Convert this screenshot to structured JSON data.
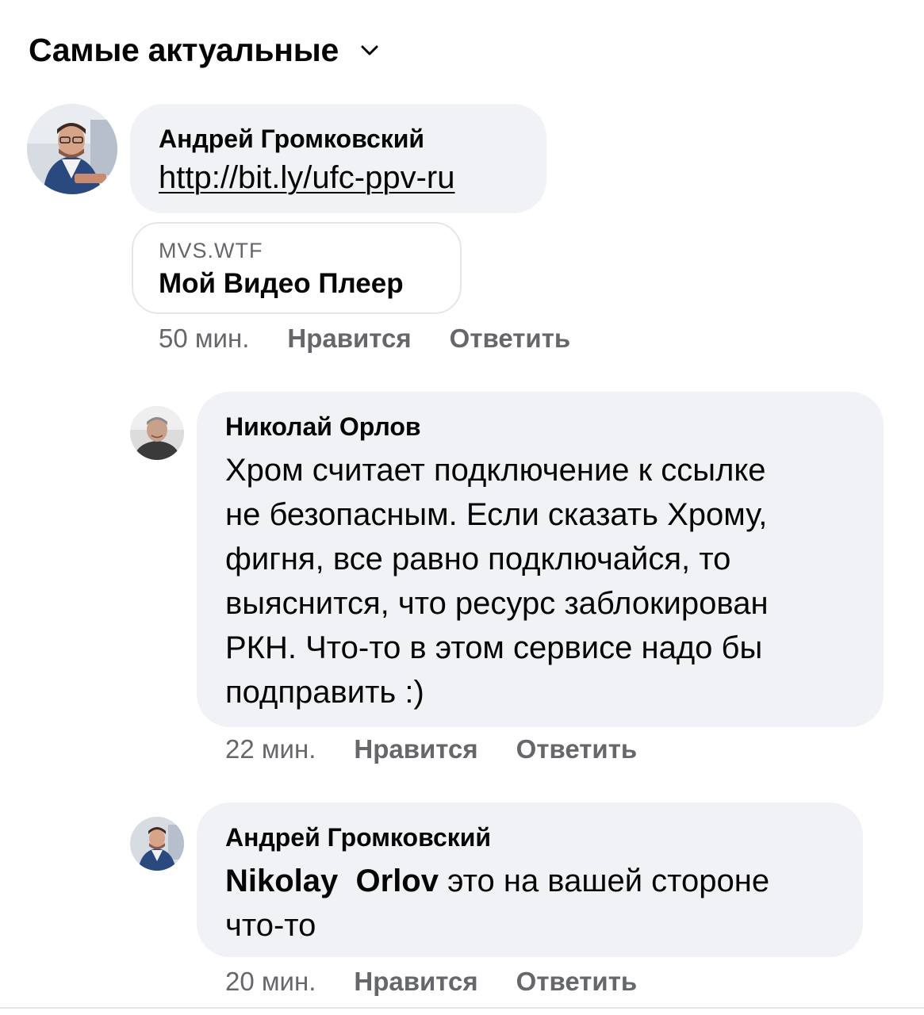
{
  "header": {
    "sort_label": "Самые актуальные"
  },
  "comments": [
    {
      "author": "Андрей Громковский",
      "link": "http://bit.ly/ufc-ppv-ru",
      "preview": {
        "domain": "MVS.WTF",
        "title": "Мой Видео Плеер"
      },
      "time": "50 мин.",
      "like_label": "Нравится",
      "reply_label": "Ответить"
    },
    {
      "author": "Николай Орлов",
      "text_lines": [
        "Хром считает подключение к ссылке",
        "не безопасным. Если сказать Хрому,",
        "фигня, все равно подключайся, то",
        "выяснится, что ресурс заблокирован",
        "РКН. Что-то в этом сервисе надо бы",
        "подправить :)"
      ],
      "time": "22 мин.",
      "like_label": "Нравится",
      "reply_label": "Ответить"
    },
    {
      "author": "Андрей Громковский",
      "mention": "Nikolay  Orlov",
      "text_after_mention": " это на вашей стороне",
      "text_line2": "что-то",
      "time": "20 мин.",
      "like_label": "Нравится",
      "reply_label": "Ответить"
    }
  ]
}
